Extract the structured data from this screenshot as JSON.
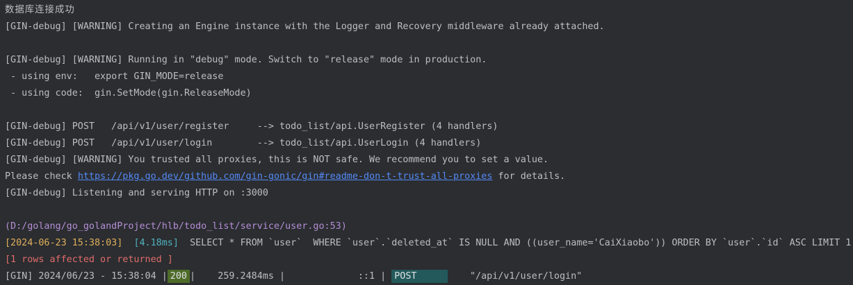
{
  "console": {
    "db_message": "数据库连接成功",
    "lines": [
      "[GIN-debug] [WARNING] Creating an Engine instance with the Logger and Recovery middleware already attached.",
      "",
      "[GIN-debug] [WARNING] Running in \"debug\" mode. Switch to \"release\" mode in production.",
      " - using env:   export GIN_MODE=release",
      " - using code:  gin.SetMode(gin.ReleaseMode)",
      "",
      "[GIN-debug] POST   /api/v1/user/register     --> todo_list/api.UserRegister (4 handlers)",
      "[GIN-debug] POST   /api/v1/user/login        --> todo_list/api.UserLogin (4 handlers)",
      "[GIN-debug] [WARNING] You trusted all proxies, this is NOT safe. We recommend you to set a value."
    ],
    "proxy_check": {
      "prefix": "Please check ",
      "link": "https://pkg.go.dev/github.com/gin-gonic/gin#readme-don-t-trust-all-proxies",
      "suffix": " for details."
    },
    "listening": "[GIN-debug] Listening and serving HTTP on :3000",
    "gorm": {
      "path": "(D:/golang/go_golandProject/hlb/todo_list/service/user.go:53)",
      "timestamp": "[2024-06-23 15:38:03]",
      "duration": "[4.18ms]",
      "sql": "SELECT * FROM `user`  WHERE `user`.`deleted_at` IS NULL AND ((user_name='CaiXiaobo')) ORDER BY `user`.`id` ASC LIMIT 1",
      "rows": "[1 rows affected or returned ]"
    },
    "request_log": {
      "prefix": "[GIN] 2024/06/23 - 15:38:04 |",
      "status": "200",
      "latency": "|    259.2484ms |             ::1 |",
      "method": "POST",
      "path": "    \"/api/v1/user/login\""
    }
  },
  "colors": {
    "background": "#2b2d30",
    "text": "#bcbec4",
    "link": "#548af7",
    "gorm_path": "#b48ed6",
    "gorm_timestamp": "#e0b05c",
    "gorm_duration": "#4fb3bf",
    "gorm_rows": "#e06c6c",
    "status_badge": "#4e6b28",
    "method_badge": "#23595a"
  }
}
